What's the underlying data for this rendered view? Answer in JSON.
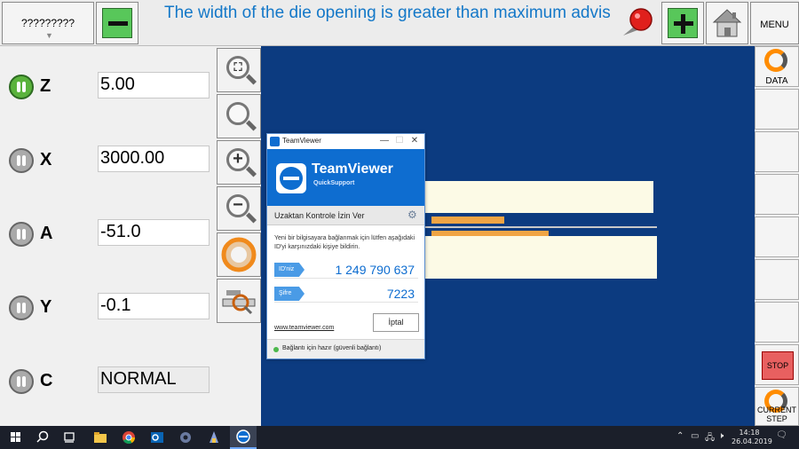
{
  "toolbar": {
    "selector_label": "?????????",
    "message": "The width of the die opening is greater than maximum advis",
    "menu_label": "MENU"
  },
  "axes": [
    {
      "label": "Z",
      "value": "5.00"
    },
    {
      "label": "X",
      "value": "3000.00"
    },
    {
      "label": "A",
      "value": "-51.0"
    },
    {
      "label": "Y",
      "value": "-0.1"
    },
    {
      "label": "C",
      "value": "NORMAL"
    }
  ],
  "right_buttons": {
    "data_label": "DATA",
    "stop_label": "STOP",
    "current_step_label": "CURRENT STEP"
  },
  "teamviewer": {
    "window_title": "TeamViewer",
    "brand": "TeamViewer",
    "product": "QuickSupport",
    "heading": "Uzaktan Kontrole İzin Ver",
    "description": "Yeni bir bilgisayara bağlanmak için lütfen aşağıdaki ID'yi karşınızdaki kişiye bildirin.",
    "id_label": "ID'niz",
    "id_value": "1 249 790 637",
    "password_label": "Şifre",
    "password_value": "7223",
    "link": "www.teamviewer.com",
    "cancel_label": "İptal",
    "status": "Bağlantı için hazır (güvenli bağlantı)"
  },
  "taskbar": {
    "time": "14:18",
    "date": "26.04.2019"
  },
  "colors": {
    "message": "#1478c8",
    "canvas_bg": "#0c3b80",
    "teamviewer_blue": "#0e6dd0",
    "active_axis": "#5ab33c",
    "stop": "#e86060",
    "part": "#fcfae6",
    "die_strip": "#f0a444"
  }
}
